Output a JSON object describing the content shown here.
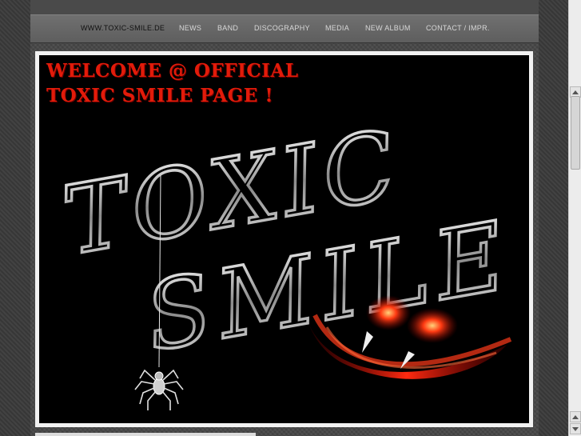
{
  "nav": {
    "items": [
      {
        "label": "WWW.TOXIC-SMILE.DE"
      },
      {
        "label": "NEWS"
      },
      {
        "label": "BAND"
      },
      {
        "label": "DISCOGRAPHY"
      },
      {
        "label": "MEDIA"
      },
      {
        "label": "NEW ALBUM"
      },
      {
        "label": "CONTACT / IMPR."
      }
    ]
  },
  "banner": {
    "welcome_line1": "WELCOME @ OFFICIAL",
    "welcome_line2": "TOXIC SMILE PAGE !",
    "logo_word1": "TOXIC",
    "logo_word2": "SMILE",
    "accent_color": "#e21b0a"
  },
  "icons": {
    "scroll_up": "arrow-up-icon",
    "scroll_down": "arrow-down-icon",
    "spider": "spider-icon",
    "face": "evil-smile-icon"
  }
}
